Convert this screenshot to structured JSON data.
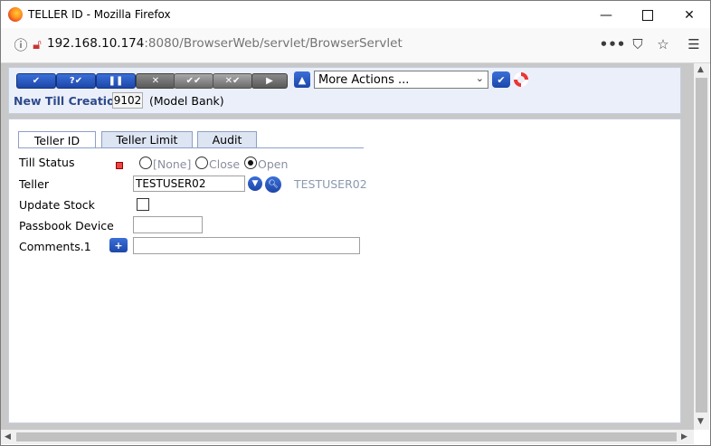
{
  "window": {
    "title": "TELLER ID - Mozilla Firefox",
    "minimize_icon": "minimize-icon",
    "maximize_icon": "maximize-icon",
    "close_icon": "close-icon"
  },
  "browser": {
    "url_host": "192.168.10.174",
    "url_tail": ":8080/BrowserWeb/servlet/BrowserServlet"
  },
  "toolbar": {
    "buttons": [
      {
        "name": "commit",
        "icon": "✔"
      },
      {
        "name": "validate",
        "icon": "?✔"
      },
      {
        "name": "hold",
        "icon": "❚❚"
      },
      {
        "name": "delete",
        "icon": "✕"
      },
      {
        "name": "authorise",
        "icon": "✔✔"
      },
      {
        "name": "reverse",
        "icon": "✕✔"
      },
      {
        "name": "view",
        "icon": "▶"
      }
    ],
    "actions_selected": "More Actions ...",
    "screen_title": "New Till Creation",
    "till_id": "9102",
    "company": "(Model Bank)"
  },
  "tabs": [
    {
      "label": "Teller ID"
    },
    {
      "label": "Teller Limit"
    },
    {
      "label": "Audit"
    }
  ],
  "form": {
    "till_status_label": "Till Status",
    "status_options": [
      "[None]",
      "Close",
      "Open"
    ],
    "status_selected": "Open",
    "teller_label": "Teller",
    "teller_value": "TESTUSER02",
    "teller_enrichment": "TESTUSER02",
    "update_stock_label": "Update Stock",
    "update_stock_checked": false,
    "passbook_label": "Passbook Device",
    "passbook_value": "",
    "comments_label": "Comments.1",
    "comments_value": ""
  },
  "colors": {
    "button_blue": "#1d47a8",
    "panel_bg": "#eaeffa",
    "title_blue": "#2e4a8a"
  }
}
